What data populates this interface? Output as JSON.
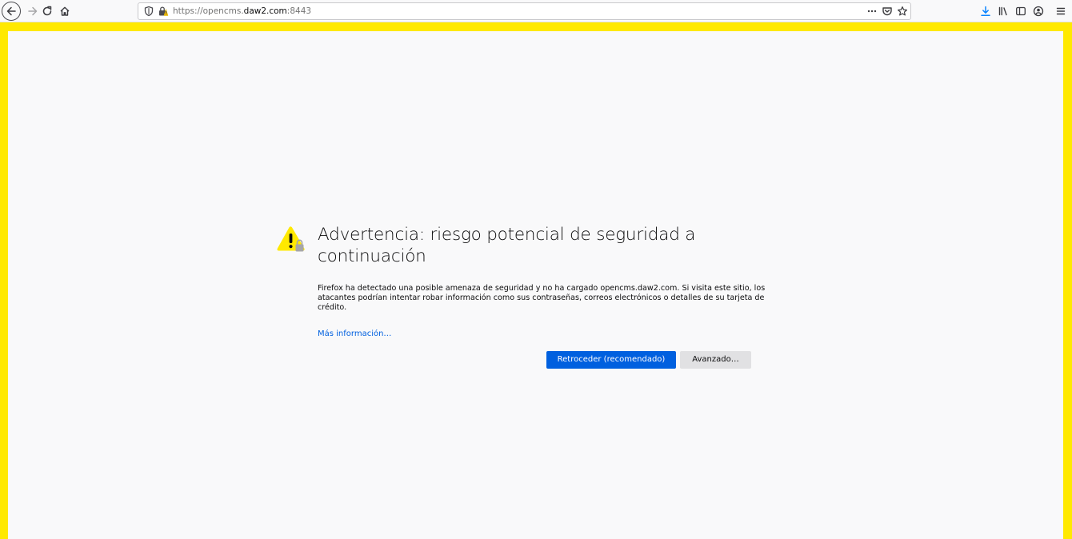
{
  "toolbar": {
    "url_scheme": "https://opencms.",
    "url_host": "daw2.com",
    "url_port": ":8443",
    "icons": [
      "back-icon",
      "forward-icon",
      "reload-icon",
      "home-icon",
      "tracking-shield-icon",
      "insecure-lock-icon",
      "page-actions-icon",
      "pocket-icon",
      "bookmark-star-icon",
      "downloads-icon",
      "library-icon",
      "sidebar-icon",
      "account-icon",
      "menu-icon"
    ]
  },
  "colors": {
    "frame": "#ffe900",
    "page_background": "#f9f9fa",
    "primary_button": "#0060df",
    "link": "#0060df",
    "downloads_icon": "#0a84ff"
  },
  "error_page": {
    "title": "Advertencia: riesgo potencial de seguridad a continuación",
    "description": "Firefox ha detectado una posible amenaza de seguridad y no ha cargado opencms.daw2.com. Si visita este sitio, los atacantes podrían intentar robar información como sus contraseñas, correos electrónicos o detalles de su tarjeta de crédito.",
    "learn_more": "Más información…",
    "go_back_button": "Retroceder (recomendado)",
    "advanced_button": "Avanzado…"
  }
}
